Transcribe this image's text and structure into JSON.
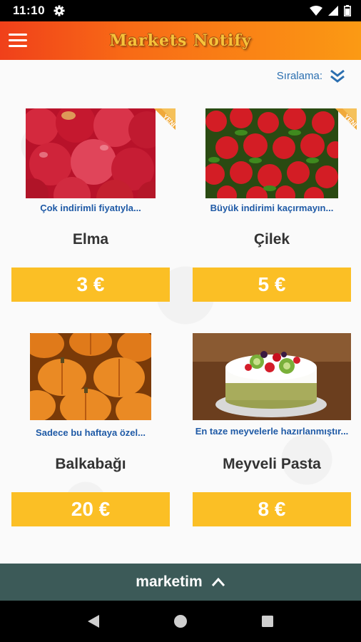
{
  "status_bar": {
    "time": "11:10"
  },
  "app_bar": {
    "title": "Markets Notify"
  },
  "sort": {
    "label": "Sıralama:"
  },
  "products": [
    {
      "badge": "YENİ",
      "description": "Çok indirimli fiyatıyla...",
      "name": "Elma",
      "price": "3 €",
      "image": "apples"
    },
    {
      "badge": "YENİ",
      "description": "Büyük indirimi kaçırmayın...",
      "name": "Çilek",
      "price": "5 €",
      "image": "strawberries"
    },
    {
      "badge": "",
      "description": "Sadece bu haftaya özel...",
      "name": "Balkabağı",
      "price": "20 €",
      "image": "pumpkins"
    },
    {
      "badge": "",
      "description": "En taze meyvelerle hazırlanmıştır...",
      "name": "Meyveli Pasta",
      "price": "8 €",
      "image": "fruit-cake"
    }
  ],
  "bottom_bar": {
    "label": "marketim"
  },
  "colors": {
    "price_bg": "#fbbf25",
    "link_blue": "#1f5aa6",
    "bottom_bar": "#3c5a58",
    "header_start": "#f0401a",
    "header_end": "#fb9a14"
  }
}
